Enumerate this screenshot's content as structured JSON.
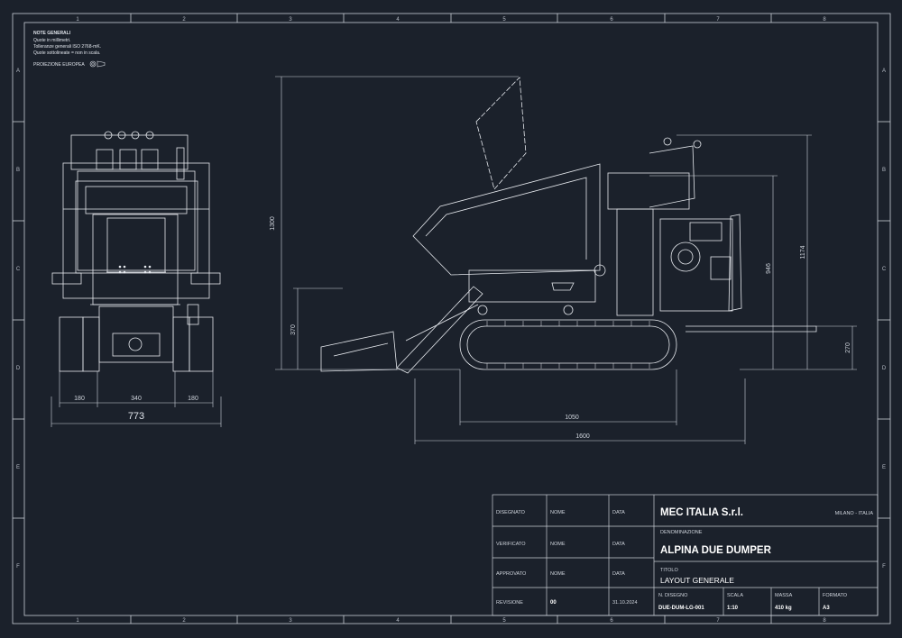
{
  "notes": {
    "title": "NOTE GENERALI",
    "lines": [
      "Quote in millimetri.",
      "Tolleranze generali ISO 2768-mK.",
      "Quote sottolineate = non in scala."
    ],
    "projection": "PROIEZIONE EUROPEA"
  },
  "grid": {
    "columns": [
      "1",
      "2",
      "3",
      "4",
      "5",
      "6",
      "7",
      "8"
    ],
    "rows": [
      "A",
      "B",
      "C",
      "D",
      "E",
      "F"
    ]
  },
  "dimensions": {
    "front_left": "180",
    "front_center": "340",
    "front_right": "180",
    "front_total": "773",
    "height_total": "1300",
    "height_bucket": "370",
    "height_engine": "1174",
    "height_handle": "946",
    "height_platform": "270",
    "track_length": "1050",
    "total_length": "1600"
  },
  "colors": {
    "highlight_dimension": "#c8652b",
    "background": "#1b212b",
    "lines": "#e6e9ee"
  },
  "title_block": {
    "disegnato_label": "DISEGNATO",
    "verificato_label": "VERIFICATO",
    "approvato_label": "APPROVATO",
    "revisione_label": "REVISIONE",
    "nome": "NOME",
    "data": "DATA",
    "revisione_value": "00",
    "revisione_date": "31.10.2024",
    "company": "MEC ITALIA S.r.l.",
    "location": "MILANO - ITALIA",
    "denominazione_label": "DENOMINAZIONE",
    "denominazione": "ALPINA DUE DUMPER",
    "titolo_label": "TITOLO",
    "titolo": "LAYOUT GENERALE",
    "n_disegno_label": "N. DISEGNO",
    "n_disegno": "DUE-DUM-LG-001",
    "scala_label": "SCALA",
    "scala": "1:10",
    "massa_label": "MASSA",
    "massa": "410 kg",
    "formato_label": "FORMATO",
    "formato": "A3"
  }
}
